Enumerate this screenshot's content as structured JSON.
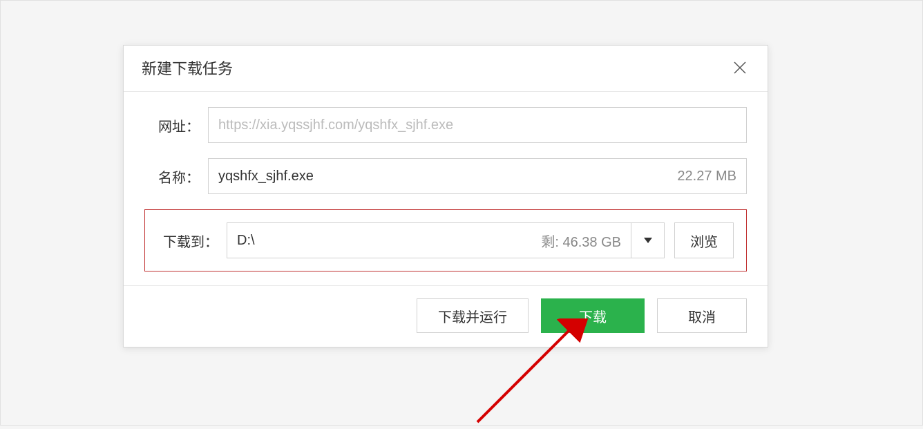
{
  "dialog": {
    "title": "新建下载任务",
    "rows": {
      "url": {
        "label": "网址：",
        "value": "https://xia.yqssjhf.com/yqshfx_sjhf.exe"
      },
      "name": {
        "label": "名称：",
        "value": "yqshfx_sjhf.exe",
        "size": "22.27 MB"
      },
      "path": {
        "label": "下载到：",
        "value": "D:\\",
        "remaining": "剩: 46.38 GB",
        "browse": "浏览"
      }
    },
    "buttons": {
      "download_run": "下载并运行",
      "download": "下载",
      "cancel": "取消"
    }
  }
}
